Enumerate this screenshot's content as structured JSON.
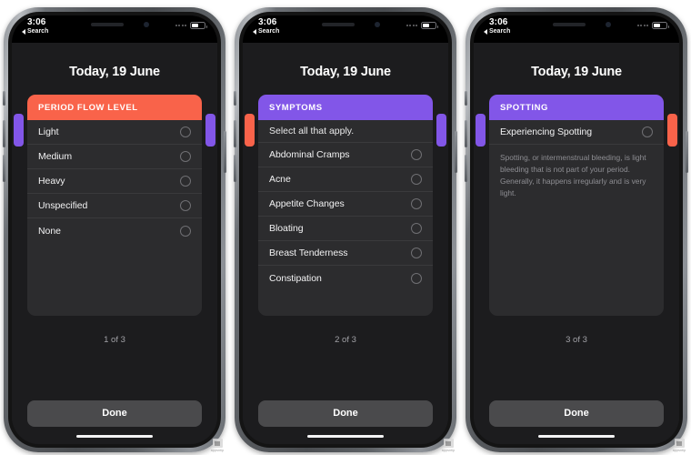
{
  "status_bar": {
    "time": "3:06",
    "back_label": "Search",
    "battery_level_pct": 52
  },
  "colors": {
    "period_red": "#f9634a",
    "symptoms_purple": "#8256e8",
    "spotting_purple": "#8256e8",
    "card_bg": "#2c2c2e",
    "screen_bg": "#1c1c1e",
    "done_btn": "#4a4a4c"
  },
  "phones": [
    {
      "id": "phone-period-flow",
      "date_title": "Today, 19 June",
      "peek_left_color": "#8256e8",
      "peek_right_color": "#8256e8",
      "card": {
        "header_label": "PERIOD FLOW LEVEL",
        "header_color": "#f9634a",
        "subtitle": null,
        "options": [
          {
            "label": "Light",
            "selected": false
          },
          {
            "label": "Medium",
            "selected": false
          },
          {
            "label": "Heavy",
            "selected": false
          },
          {
            "label": "Unspecified",
            "selected": false
          },
          {
            "label": "None",
            "selected": false
          }
        ],
        "description": null
      },
      "pager": "1 of 3",
      "done_label": "Done"
    },
    {
      "id": "phone-symptoms",
      "date_title": "Today, 19 June",
      "peek_left_color": "#f9634a",
      "peek_right_color": "#8256e8",
      "card": {
        "header_label": "SYMPTOMS",
        "header_color": "#8256e8",
        "subtitle": "Select all that apply.",
        "options": [
          {
            "label": "Abdominal Cramps",
            "selected": false
          },
          {
            "label": "Acne",
            "selected": false
          },
          {
            "label": "Appetite Changes",
            "selected": false
          },
          {
            "label": "Bloating",
            "selected": false
          },
          {
            "label": "Breast Tenderness",
            "selected": false
          },
          {
            "label": "Constipation",
            "selected": false
          }
        ],
        "description": null
      },
      "pager": "2 of 3",
      "done_label": "Done"
    },
    {
      "id": "phone-spotting",
      "date_title": "Today, 19 June",
      "peek_left_color": "#8256e8",
      "peek_right_color": "#f9634a",
      "card": {
        "header_label": "SPOTTING",
        "header_color": "#8256e8",
        "subtitle": null,
        "options": [
          {
            "label": "Experiencing Spotting",
            "selected": false
          }
        ],
        "description": "Spotting, or intermenstrual bleeding, is light bleeding that is not part of your period. Generally, it happens irregularly and is very light."
      },
      "pager": "3 of 3",
      "done_label": "Done"
    }
  ],
  "watermark": {
    "text": "appsntip"
  }
}
